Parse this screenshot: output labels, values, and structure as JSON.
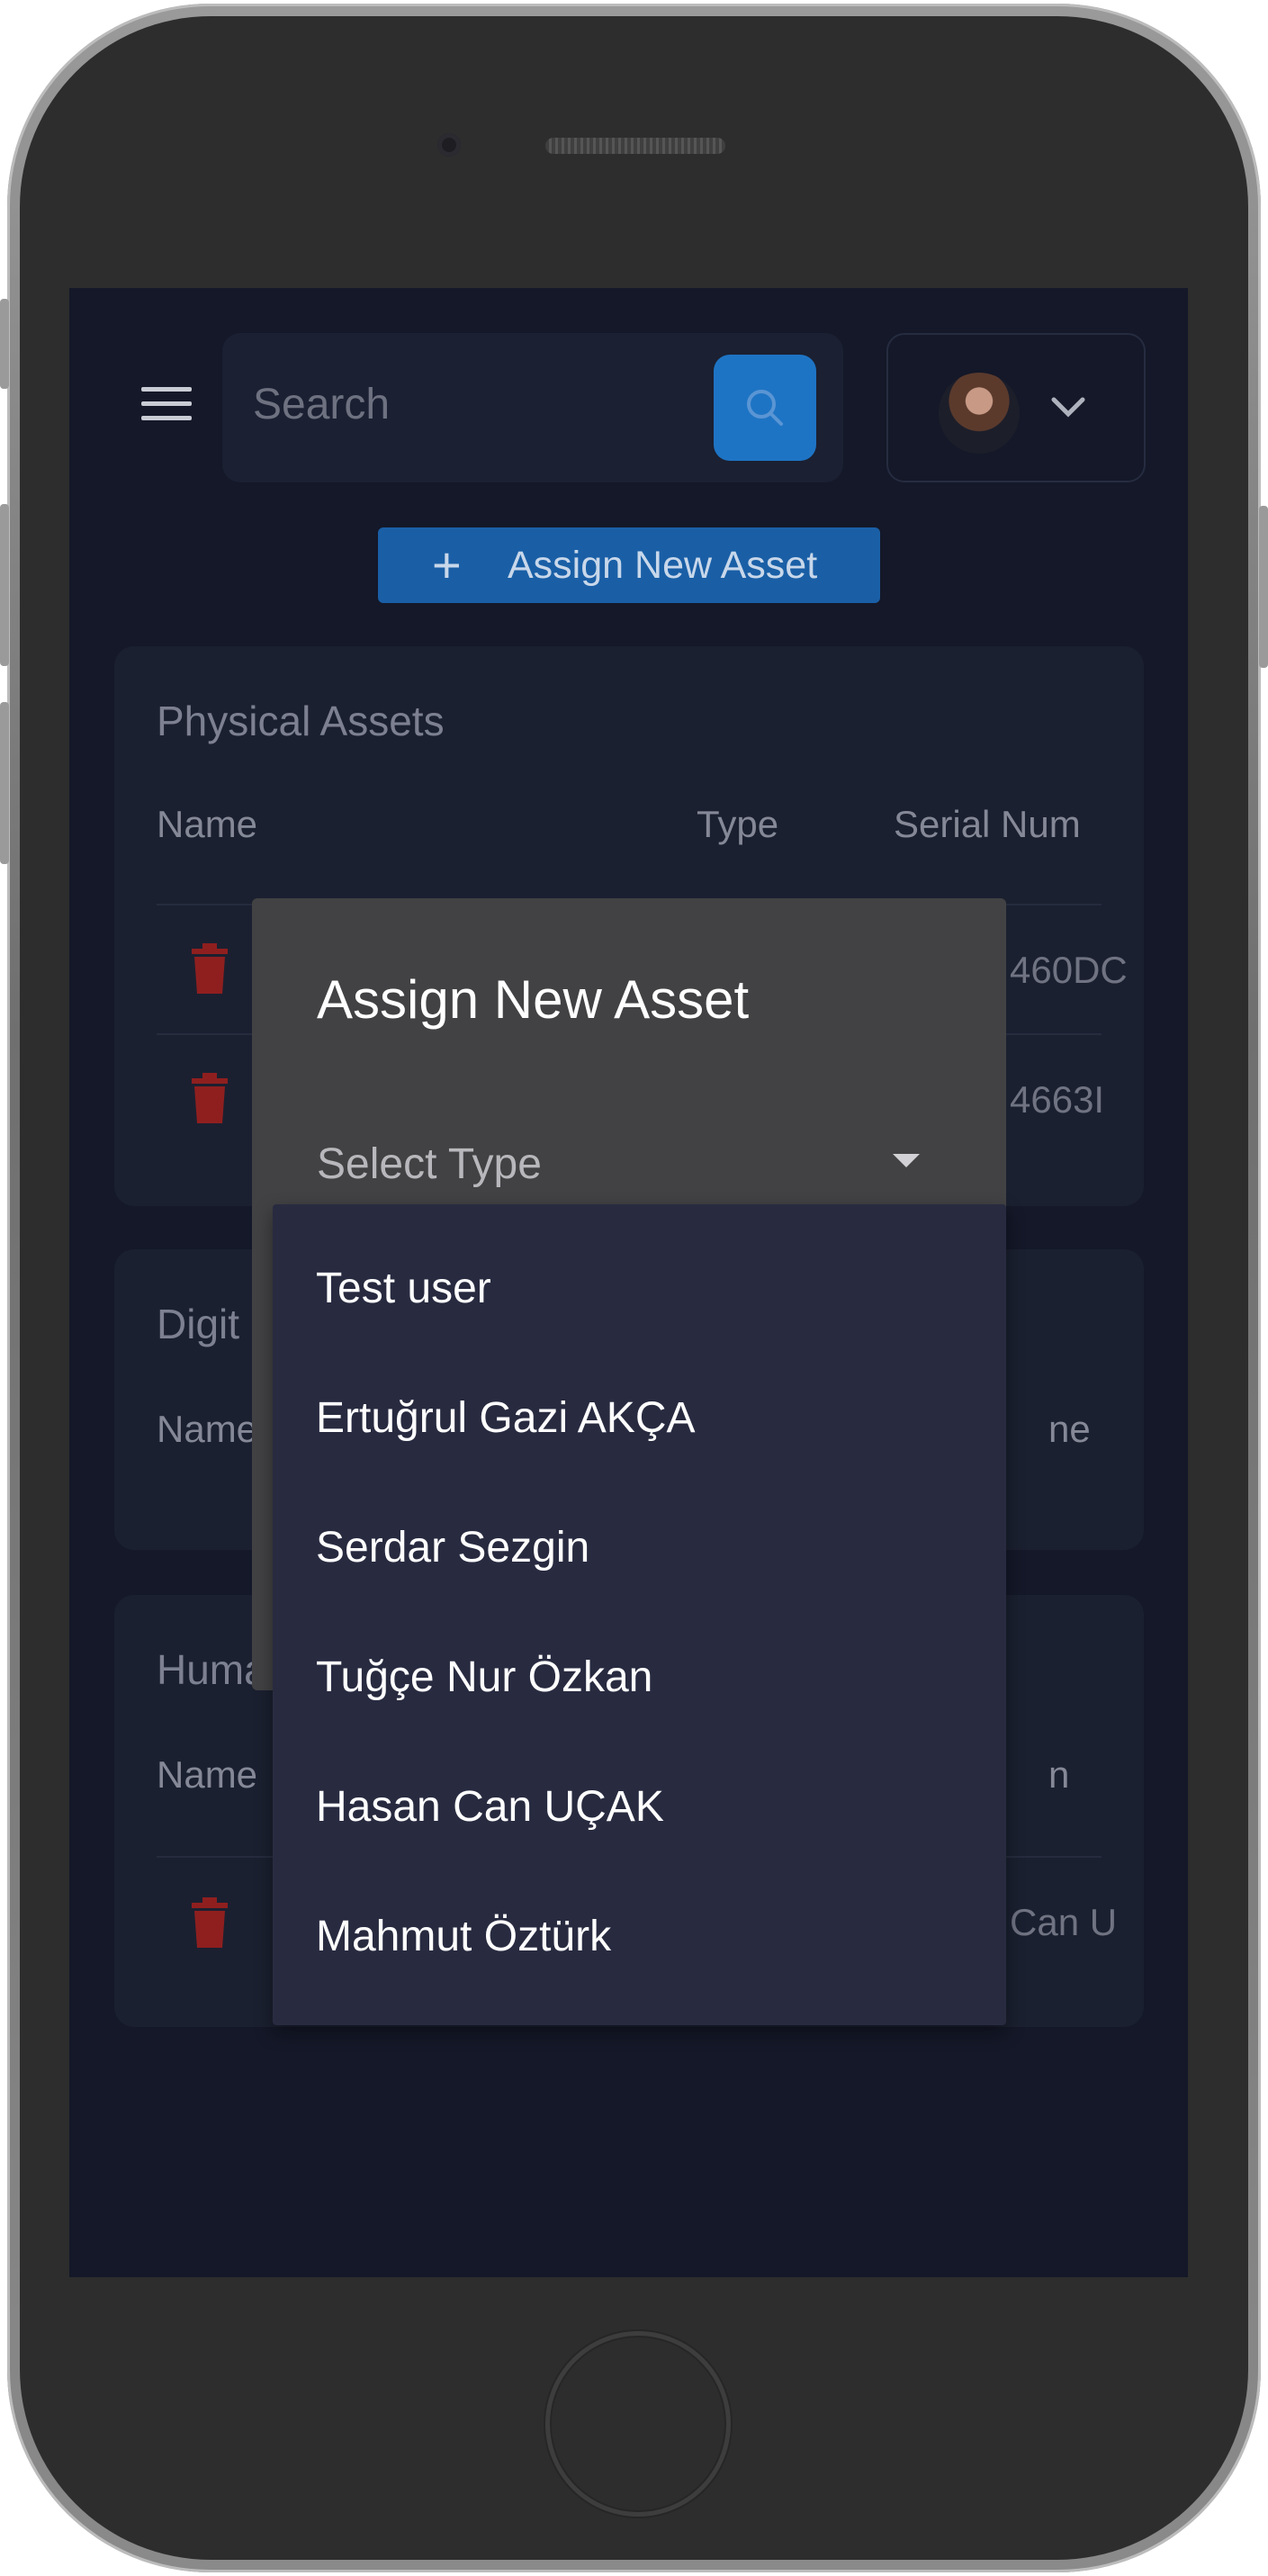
{
  "header": {
    "search_placeholder": "Search"
  },
  "assign_button_label": "Assign New Asset",
  "physical_assets": {
    "title": "Physical Assets",
    "columns": [
      "Name",
      "Type",
      "Serial Num"
    ],
    "rows": [
      {
        "serial": "460DC"
      },
      {
        "serial": "4663I"
      }
    ]
  },
  "digital_assets": {
    "title": "Digit",
    "columns": [
      "Name",
      "ne"
    ]
  },
  "human_assets": {
    "title": "Huma",
    "columns": [
      "Name",
      "n"
    ],
    "rows": [
      {
        "value": "Can U"
      }
    ]
  },
  "dialog": {
    "title": "Assign New Asset",
    "select_label": "Select Type",
    "options": [
      "Test user",
      "Ertuğrul Gazi AKÇA",
      "Serdar Sezgin",
      "Tuğçe Nur Özkan",
      "Hasan Can UÇAK",
      "Mahmut Öztürk"
    ]
  },
  "colors": {
    "accent": "#1e74c4",
    "background": "#141828",
    "card": "#1b2030",
    "dialog": "#424244",
    "dropdown": "#282b40",
    "danger": "#8f1f1f"
  }
}
